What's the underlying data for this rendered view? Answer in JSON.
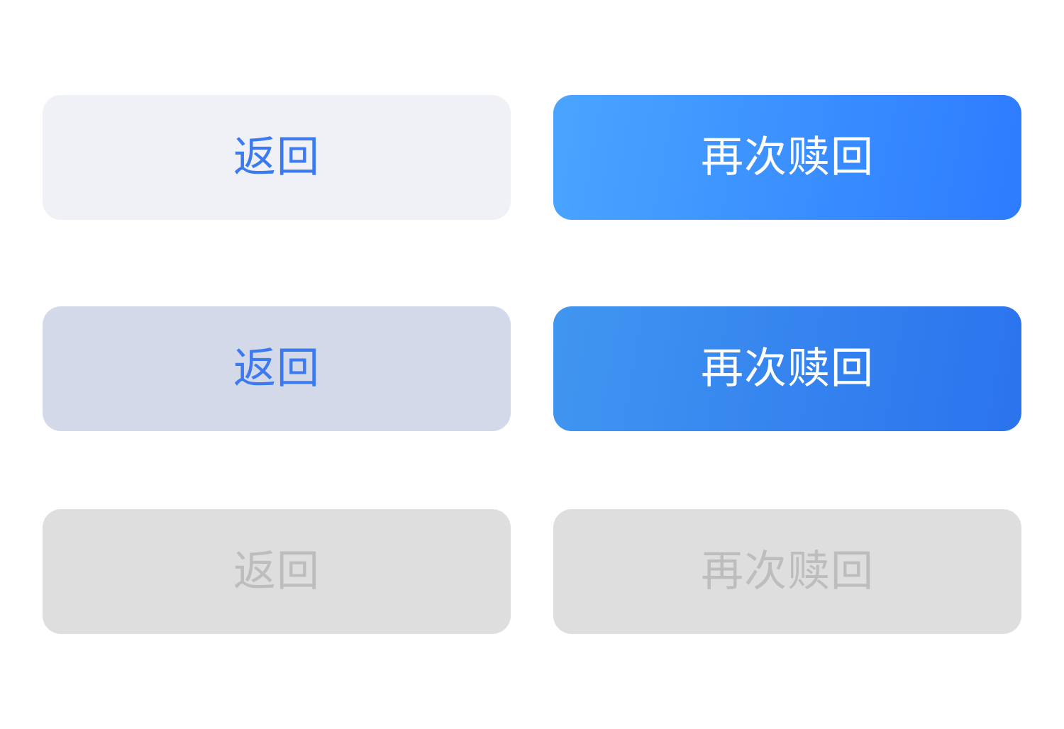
{
  "buttons": {
    "back_default": {
      "label": "返回",
      "state": "default"
    },
    "redeem_default": {
      "label": "再次赎回",
      "state": "default"
    },
    "back_pressed": {
      "label": "返回",
      "state": "pressed"
    },
    "redeem_pressed": {
      "label": "再次赎回",
      "state": "pressed"
    },
    "back_disabled": {
      "label": "返回",
      "state": "disabled"
    },
    "redeem_disabled": {
      "label": "再次赎回",
      "state": "disabled"
    }
  },
  "colors": {
    "accent_text": "#3c7af0",
    "secondary_bg": "#eff1f6",
    "secondary_pressed_bg": "#d4d9ea",
    "primary_gradient_start": "#4aa5ff",
    "primary_gradient_end": "#2d7bff",
    "disabled_bg": "#dedede",
    "disabled_text": "#bdbdbd"
  }
}
